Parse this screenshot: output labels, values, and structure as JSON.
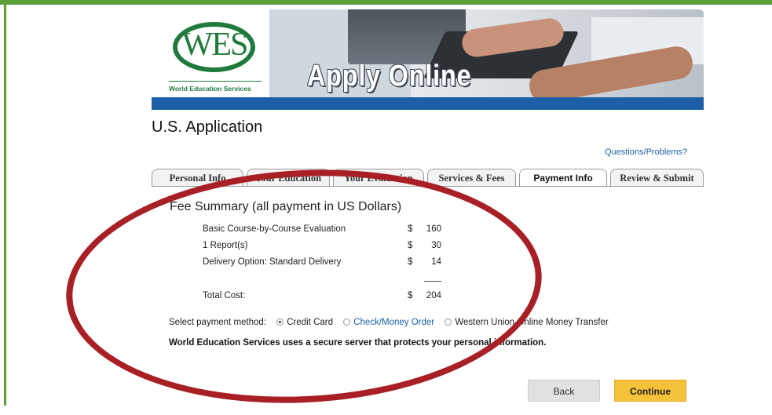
{
  "banner": {
    "logo_text": "WES",
    "logo_subtitle": "World Education Services",
    "title": "Apply Online"
  },
  "page": {
    "title": "U.S. Application",
    "help_link": "Questions/Problems?"
  },
  "tabs": [
    {
      "label": "Personal Info",
      "active": false
    },
    {
      "label": "Your Education",
      "active": false
    },
    {
      "label": "Your Evaluation",
      "active": false
    },
    {
      "label": "Services & Fees",
      "active": false
    },
    {
      "label": "Payment Info",
      "active": true
    },
    {
      "label": "Review & Submit",
      "active": false
    }
  ],
  "fee_summary": {
    "title": "Fee Summary (all payment in US Dollars)",
    "items": [
      {
        "label": "Basic Course-by-Course Evaluation",
        "currency": "$",
        "amount": "160"
      },
      {
        "label": "1 Report(s)",
        "currency": "$",
        "amount": "30"
      },
      {
        "label": "Delivery Option: Standard Delivery",
        "currency": "$",
        "amount": "14"
      }
    ],
    "total": {
      "label": "Total Cost:",
      "currency": "$",
      "amount": "204"
    }
  },
  "payment": {
    "label": "Select payment method:",
    "options": [
      {
        "label": "Credit Card",
        "selected": true
      },
      {
        "label": "Check/Money Order",
        "selected": false
      },
      {
        "label": "Western Union Online Money Transfer",
        "selected": false
      }
    ],
    "secure_note": "World Education Services uses a secure server that protects your personal information."
  },
  "buttons": {
    "back": "Back",
    "continue": "Continue"
  },
  "colors": {
    "brand_green": "#1f7a3c",
    "brand_blue": "#1d5fa6",
    "continue_yellow": "#f6c23a",
    "annotation_red": "#a82025"
  }
}
